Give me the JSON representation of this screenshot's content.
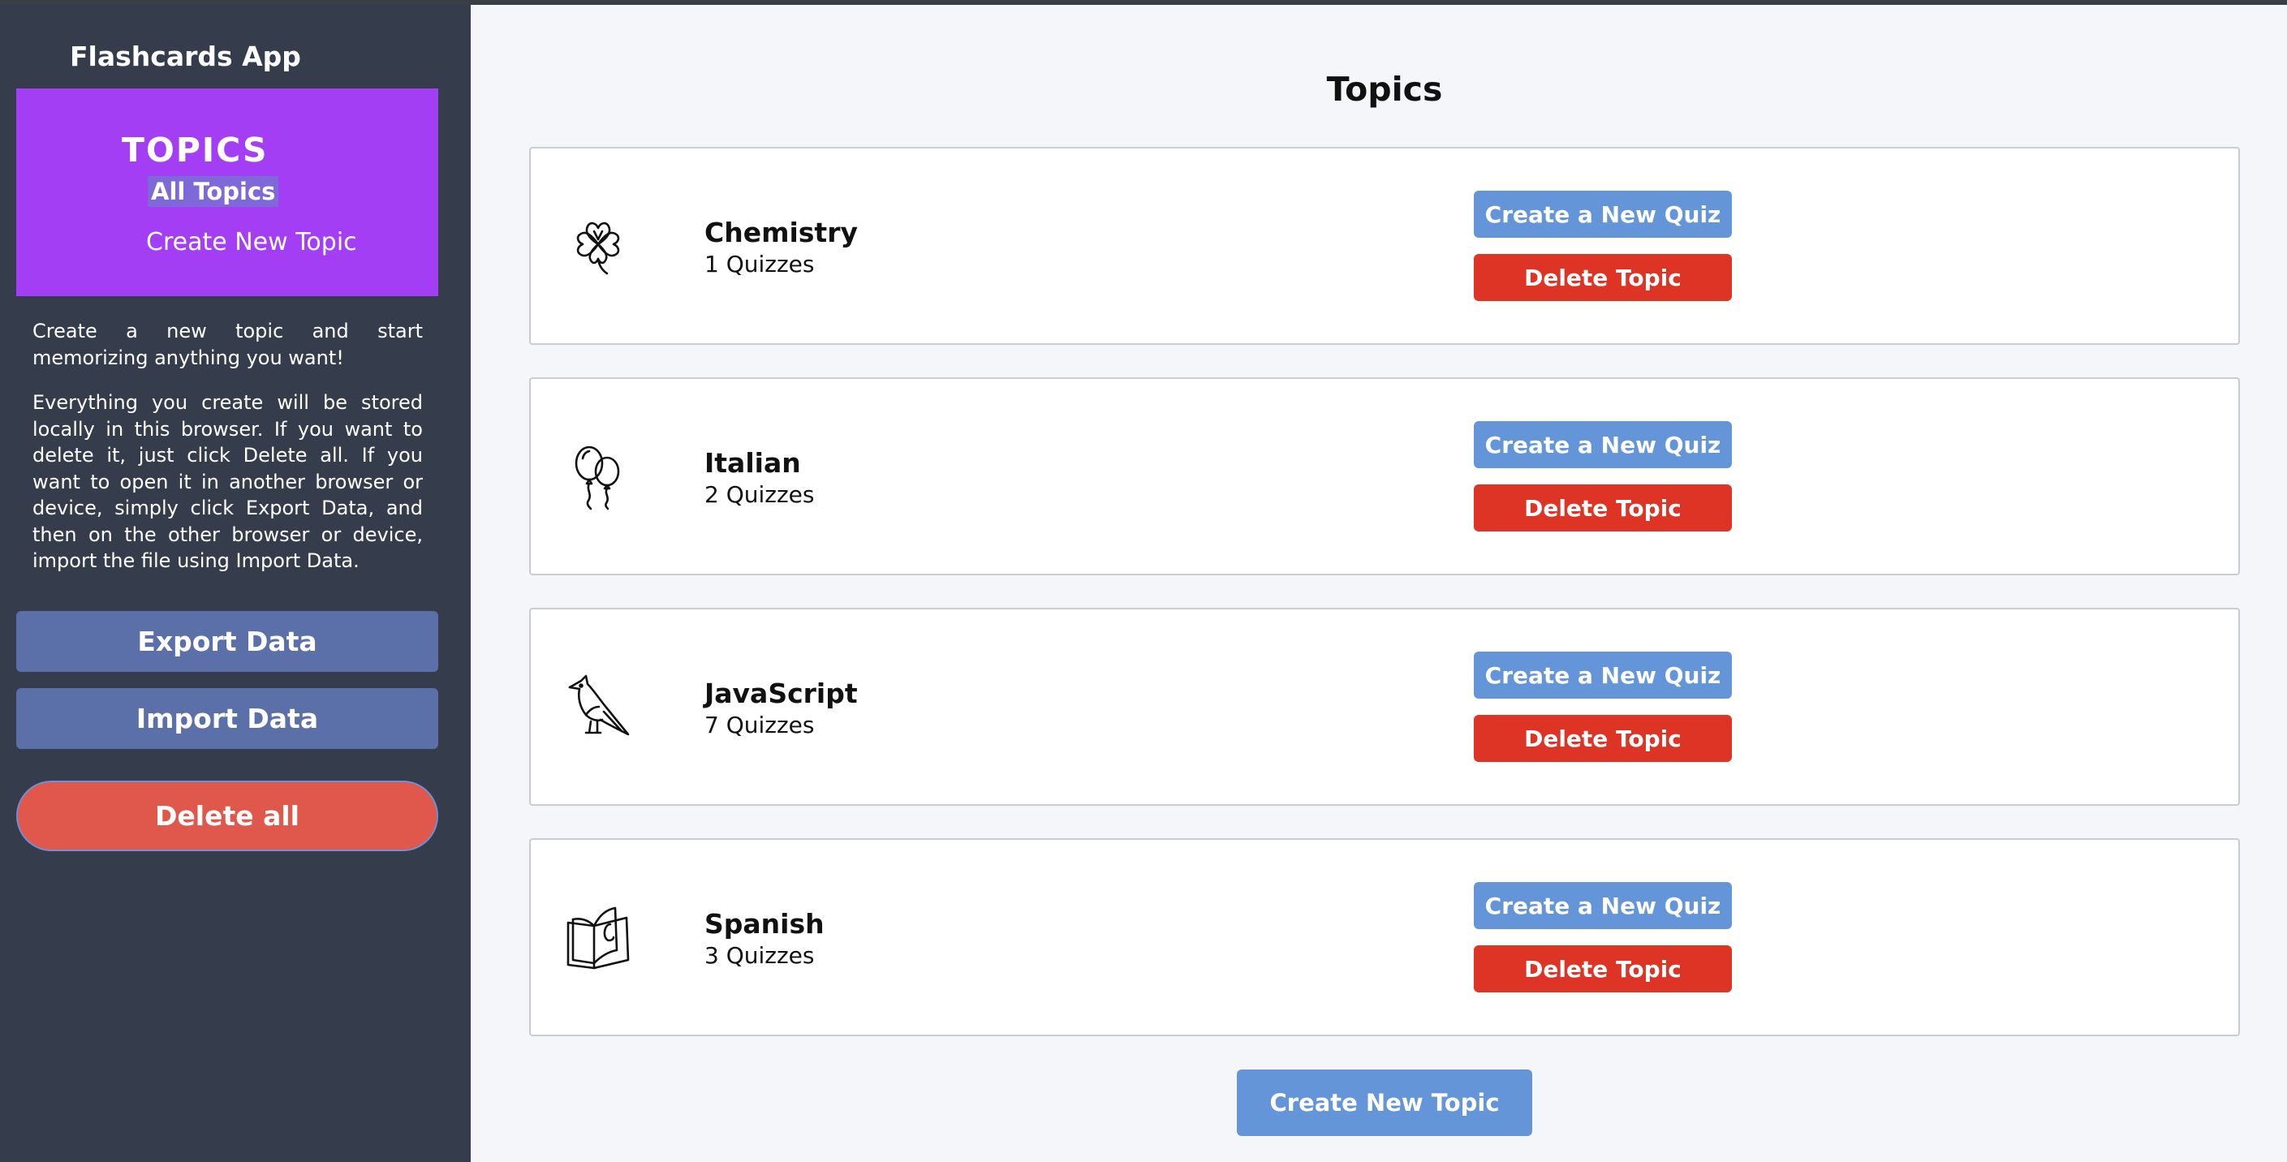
{
  "app": {
    "title": "Flashcards App"
  },
  "sidebar": {
    "heading": "TOPICS",
    "all_topics": "All Topics",
    "create_new_topic": "Create New Topic",
    "description_1": "Create a new topic and start memorizing anything you want!",
    "description_2": "Everything you create will be stored locally in this browser. If you want to delete it, just click Delete all. If you want to open it in another browser or device, simply click Export Data, and then on the other browser or device, import the file using Import Data.",
    "export_label": "Export Data",
    "import_label": "Import Data",
    "delete_all_label": "Delete all"
  },
  "main": {
    "title": "Topics",
    "create_new_topic_label": "Create New Topic",
    "topics": [
      {
        "name": "Chemistry",
        "count": "1 Quizzes",
        "icon": "four-leaf-clover-icon",
        "create_quiz": "Create a New Quiz",
        "delete": "Delete Topic"
      },
      {
        "name": "Italian",
        "count": "2 Quizzes",
        "icon": "balloons-icon",
        "create_quiz": "Create a New Quiz",
        "delete": "Delete Topic"
      },
      {
        "name": "JavaScript",
        "count": "7 Quizzes",
        "icon": "bird-icon",
        "create_quiz": "Create a New Quiz",
        "delete": "Delete Topic"
      },
      {
        "name": "Spanish",
        "count": "3 Quizzes",
        "icon": "book-icon",
        "create_quiz": "Create a New Quiz",
        "delete": "Delete Topic"
      }
    ]
  },
  "colors": {
    "sidebar_bg": "#353c4b",
    "topics_box": "#a43ef5",
    "side_button": "#5b6fa8",
    "delete_all": "#e0574c",
    "primary_button": "#6395d8",
    "danger_button": "#de3426",
    "main_bg": "#f4f6f9"
  }
}
